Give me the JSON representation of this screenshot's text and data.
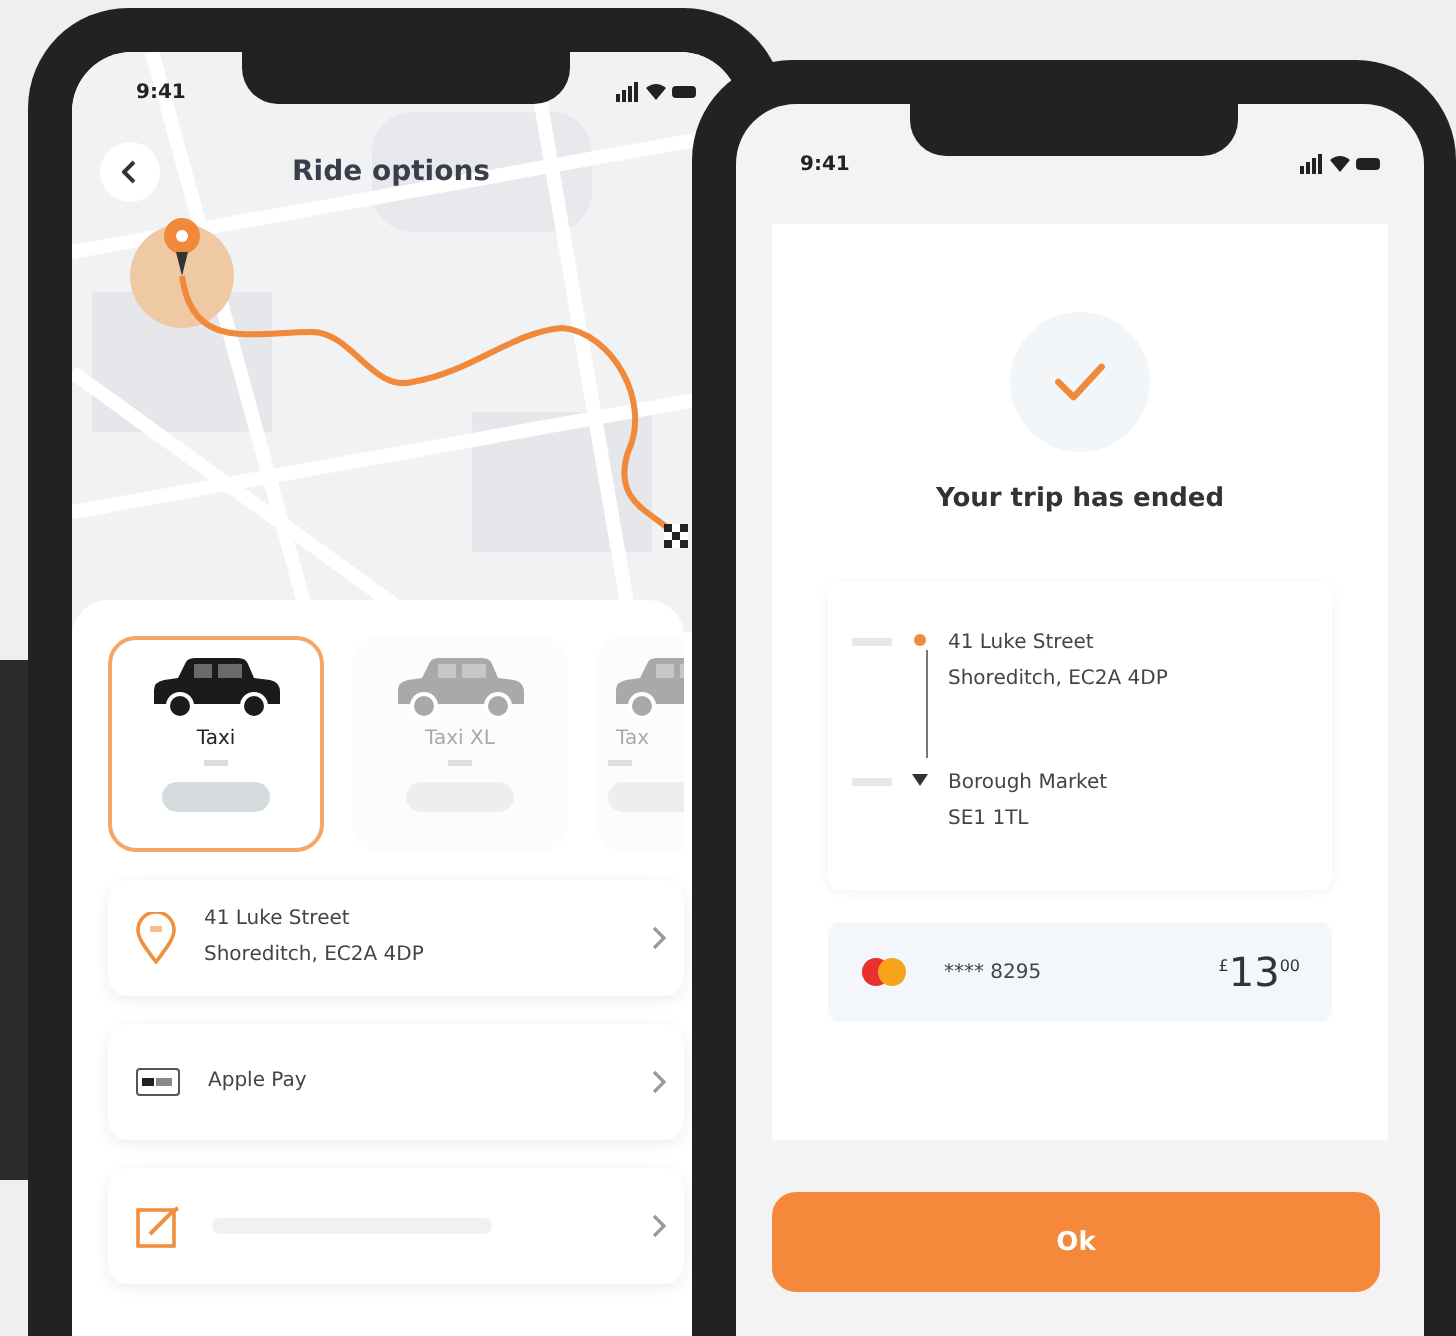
{
  "ride_options": {
    "status_time": "9:41",
    "title": "Ride options",
    "rides": [
      {
        "name": "Taxi",
        "selected": true
      },
      {
        "name": "Taxi XL",
        "selected": false
      },
      {
        "name": "Tax",
        "selected": false
      }
    ],
    "options": [
      {
        "kind": "address",
        "lines": [
          "41 Luke Street",
          "Shoreditch, EC2A 4DP"
        ]
      },
      {
        "kind": "payment",
        "lines": [
          "Apple Pay"
        ]
      },
      {
        "kind": "note"
      }
    ]
  },
  "trip_summary": {
    "status_time": "9:41",
    "title": "Your trip has ended",
    "route": [
      {
        "kind": "pickup",
        "lines": [
          "41 Luke Street",
          "Shoreditch, EC2A 4DP"
        ]
      },
      {
        "kind": "dropoff",
        "lines": [
          "Borough Market",
          "SE1 1TL"
        ]
      }
    ],
    "payment": {
      "card": "**** 8295",
      "price": "$^{£}$13$^{00}$"
    },
    "button": "Ok"
  }
}
